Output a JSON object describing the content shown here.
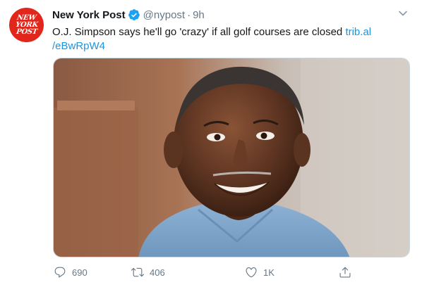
{
  "tweet": {
    "account": {
      "name": "New York Post",
      "handle": "@nypost",
      "separator": "·",
      "time": "9h",
      "avatar_lines": [
        "NEW",
        "YORK",
        "POST"
      ],
      "verified_color": "#1da1f2"
    },
    "text": {
      "body": "O.J. Simpson says he'll go 'crazy' if all golf courses are closed ",
      "link_line1": "trib.al",
      "link_line2": "/eBwRpW4"
    },
    "media": {
      "subject": "photo of a smiling man in a light blue prison shirt"
    },
    "actions": {
      "reply_count": "690",
      "retweet_count": "406",
      "like_count": "1K"
    },
    "colors": {
      "brand_red": "#e1261c",
      "link": "#1b95e0",
      "muted": "#657786"
    },
    "icons": [
      "chevron-down-icon",
      "verified-badge-icon",
      "reply-icon",
      "retweet-icon",
      "like-icon",
      "share-icon"
    ]
  }
}
